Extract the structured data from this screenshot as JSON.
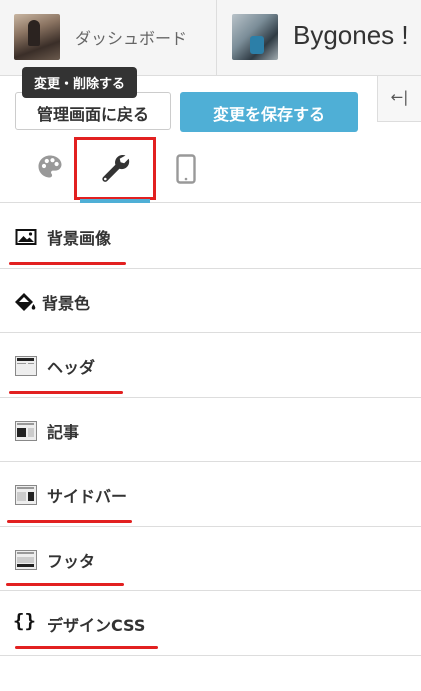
{
  "topbar": {
    "dashboard_label": "ダッシュボード",
    "tooltip": "変更・削除する",
    "blog_title": "Bygones !"
  },
  "actions": {
    "back_label": "管理画面に戻る",
    "save_label": "変更を保存する",
    "collapse_glyph": "←|"
  },
  "tabs": [
    {
      "name": "palette-icon",
      "active": false
    },
    {
      "name": "wrench-icon",
      "active": true
    },
    {
      "name": "mobile-icon",
      "active": false
    }
  ],
  "menu": {
    "items": [
      {
        "label": "背景画像",
        "icon": "image-icon",
        "underlined": true
      },
      {
        "label": "背景色",
        "icon": "paint-bucket-icon",
        "underlined": false
      },
      {
        "label": "ヘッダ",
        "icon": "header-layout-icon",
        "underlined": true
      },
      {
        "label": "記事",
        "icon": "article-layout-icon",
        "underlined": false
      },
      {
        "label": "サイドバー",
        "icon": "sidebar-layout-icon",
        "underlined": true
      },
      {
        "label": "フッタ",
        "icon": "footer-layout-icon",
        "underlined": true
      },
      {
        "label": "デザインCSS",
        "icon": "css-braces-icon",
        "underlined": true
      }
    ]
  },
  "colors": {
    "accent": "#4fafd6",
    "highlight": "#e22020"
  }
}
